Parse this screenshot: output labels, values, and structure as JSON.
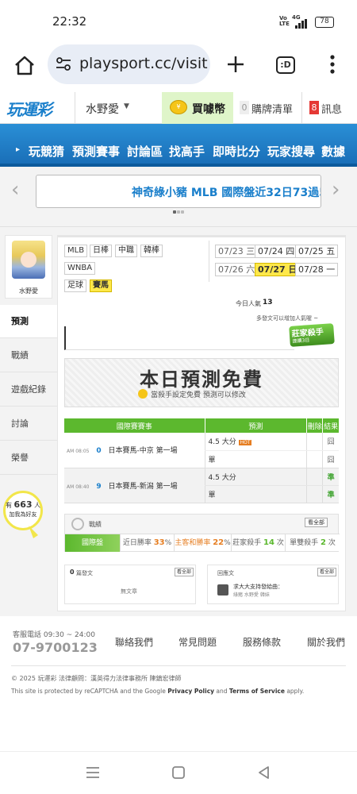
{
  "status": {
    "time": "22:32",
    "signal": "4G",
    "volte": "Vo LTE",
    "battery": "78"
  },
  "browser": {
    "url": "playsport.cc/visit",
    "tabs_count": ":D"
  },
  "site": {
    "logo": "玩運彩",
    "user": "水野愛",
    "buy_coins": "買噱幣",
    "cart_count": "0",
    "cart": "購牌清單",
    "msg_count": "8",
    "messages": "訊息"
  },
  "nav": [
    "玩競猜",
    "預測賽事",
    "討論區",
    "找高手",
    "即時比分",
    "玩家搜尋",
    "數據"
  ],
  "ticker": {
    "text": "神奇綠小豬 MLB 國際盤近32日73過5"
  },
  "profile": {
    "name": "水野愛"
  },
  "sidebar": [
    "預測",
    "戰績",
    "遊戲紀錄",
    "討論",
    "榮譽"
  ],
  "fans": {
    "prefix": "有",
    "count": "663",
    "suffix": "人",
    "label": "加我為好友"
  },
  "leagues": [
    {
      "label": "MLB",
      "active": false
    },
    {
      "label": "日棒",
      "active": false
    },
    {
      "label": "中職",
      "active": false
    },
    {
      "label": "韓棒",
      "active": false
    },
    {
      "label": "WNBA",
      "active": false
    },
    {
      "label": "足球",
      "active": false
    },
    {
      "label": "賽馬",
      "active": true
    }
  ],
  "dates": [
    {
      "label": "07/23 三",
      "active": false
    },
    {
      "label": "07/24 四",
      "active": false
    },
    {
      "label": "07/25 五",
      "active": false
    },
    {
      "label": "07/26 六",
      "active": false
    },
    {
      "label": "07/27 日",
      "active": true
    },
    {
      "label": "07/28 一",
      "active": false
    }
  ],
  "popularity": {
    "label": "今日人氣",
    "value": "13",
    "hint": "多發文可以增加人氣喔 ~"
  },
  "badge": {
    "line1": "莊家殺手",
    "line2": "連續3日"
  },
  "free_banner": {
    "title": "本日預測免費",
    "sub": "當殺手設定免費  預測可以修改"
  },
  "table": {
    "headers": [
      "國際賽賽事",
      "預測",
      "刪除",
      "結果"
    ],
    "rows": [
      {
        "time": "AM 08:05",
        "num": "0",
        "event": "日本賽馬-中京 第一場",
        "picks": [
          {
            "text": "4.5 大分",
            "tag": "HOT",
            "result": "囧"
          },
          {
            "text": "單",
            "tag": "",
            "result": "囧"
          }
        ]
      },
      {
        "time": "AM 08:40",
        "num": "9",
        "event": "日本賽馬-新潟 第一場",
        "picks": [
          {
            "text": "4.5 大分",
            "tag": "",
            "result": "準"
          },
          {
            "text": "單",
            "tag": "",
            "result": "準"
          }
        ]
      }
    ]
  },
  "stats": {
    "title": "戰績",
    "view_all": "看全部",
    "cells": [
      {
        "label": "國際盤",
        "value": ""
      },
      {
        "label": "近日勝率",
        "value": "33",
        "unit": "%"
      },
      {
        "label": "主客和勝率",
        "value": "22",
        "unit": "%"
      },
      {
        "label": "莊家殺手",
        "value": "14",
        "unit": "次"
      },
      {
        "label": "單雙殺手",
        "value": "2",
        "unit": "次"
      }
    ]
  },
  "posts": {
    "count": "0",
    "label": "篇發文",
    "view_all": "看全部",
    "empty": "無文章"
  },
  "replies": {
    "label": "回應文",
    "view_all": "看全部",
    "title": "求大大支持發給曲：",
    "meta": "綠豬 水野愛 韓妹"
  },
  "footer": {
    "service_label": "客服電話 09:30 ~ 24:00",
    "phone": "07-9700123",
    "links": [
      "聯絡我們",
      "常見問題",
      "服務條款",
      "關於我們"
    ],
    "copyright": "© 2025 玩運彩  法律顧問：漢英得力法律事務所  陳鎮宏律師",
    "recaptcha_pre": "This site is protected by reCAPTCHA and the Google ",
    "privacy": "Privacy Policy",
    "and": " and ",
    "terms": "Terms of Service",
    "apply": " apply."
  },
  "colors": {
    "nav_blue": "#1a7fcb",
    "green": "#5cb82e",
    "orange": "#e67e22",
    "gray_bg": "#f3f3f3"
  }
}
